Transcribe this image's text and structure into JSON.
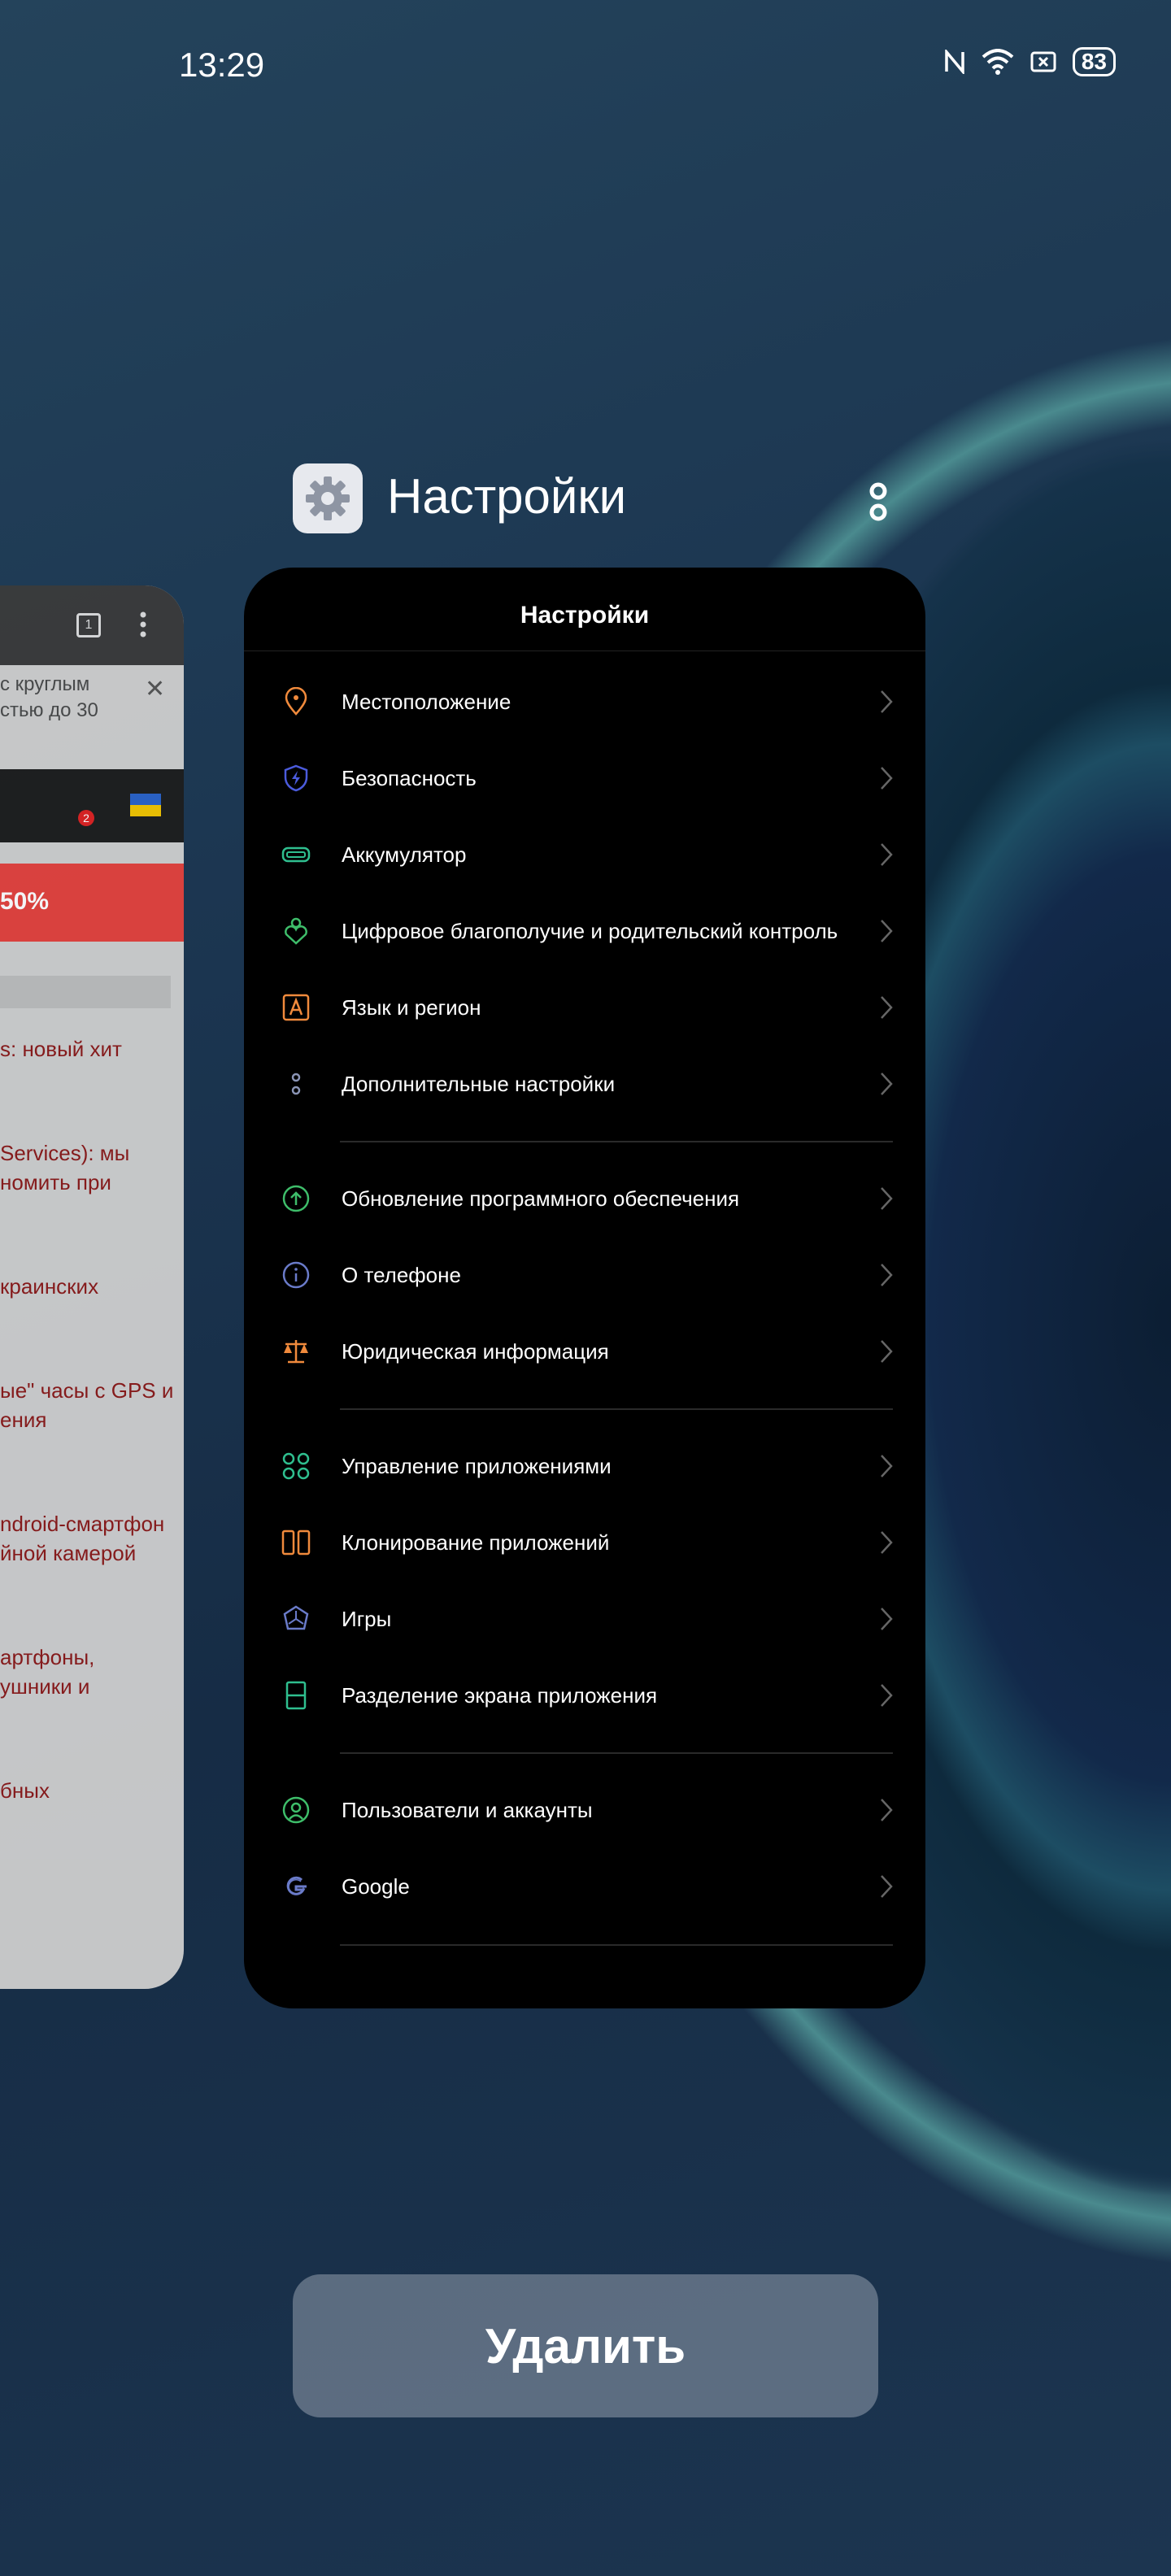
{
  "status_bar": {
    "time": "13:29",
    "icons": [
      "nfc-icon",
      "wifi-icon",
      "sim-off-icon"
    ],
    "battery": "83"
  },
  "app": {
    "name": "Настройки",
    "icon": "gear-icon",
    "more_icon": "more-vertical-icon"
  },
  "card": {
    "title": "Настройки",
    "sections": [
      {
        "items": [
          {
            "label": "Местоположение",
            "icon": "location-pin-icon",
            "color": "#f08a3c"
          },
          {
            "label": "Безопасность",
            "icon": "shield-bolt-icon",
            "color": "#4b5bdc"
          },
          {
            "label": "Аккумулятор",
            "icon": "battery-icon",
            "color": "#2fbf8f"
          },
          {
            "label": "Цифровое благополучие и родительский контроль",
            "icon": "wellbeing-heart-icon",
            "color": "#3ebd6a"
          },
          {
            "label": "Язык и регион",
            "icon": "language-a-icon",
            "color": "#f08a3c"
          },
          {
            "label": "Дополнительные настройки",
            "icon": "more-settings-icon",
            "color": "#8a94b5"
          }
        ]
      },
      {
        "items": [
          {
            "label": "Обновление программного обеспечения",
            "icon": "update-arrow-icon",
            "color": "#3ebd6a"
          },
          {
            "label": "О телефоне",
            "icon": "info-icon",
            "color": "#6a7bc9"
          },
          {
            "label": "Юридическая информация",
            "icon": "scales-icon",
            "color": "#f08a3c"
          }
        ]
      },
      {
        "items": [
          {
            "label": "Управление приложениями",
            "icon": "apps-grid-icon",
            "color": "#2fbf8f"
          },
          {
            "label": "Клонирование приложений",
            "icon": "clone-apps-icon",
            "color": "#f08a3c"
          },
          {
            "label": "Игры",
            "icon": "games-icon",
            "color": "#6a7bc9"
          },
          {
            "label": "Разделение экрана приложения",
            "icon": "split-screen-icon",
            "color": "#2fbf8f"
          }
        ]
      },
      {
        "items": [
          {
            "label": "Пользователи и аккаунты",
            "icon": "users-icon",
            "color": "#3ebd6a"
          },
          {
            "label": "Google",
            "icon": "google-g-icon",
            "color": "#6a7bc9"
          }
        ]
      }
    ]
  },
  "background_card": {
    "tab_count": "1",
    "news_snippet": [
      "с круглым",
      "стью до 30"
    ],
    "badge": "2",
    "ad_text": "50%",
    "links": [
      "s: новый хит",
      "Services): мы\nномить при",
      "краинских",
      "ые\" часы с GPS и\nения",
      "ndroid-смартфон\nйной камерой",
      "артфоны,\nушники и",
      "бных"
    ]
  },
  "actions": {
    "delete_label": "Удалить"
  }
}
